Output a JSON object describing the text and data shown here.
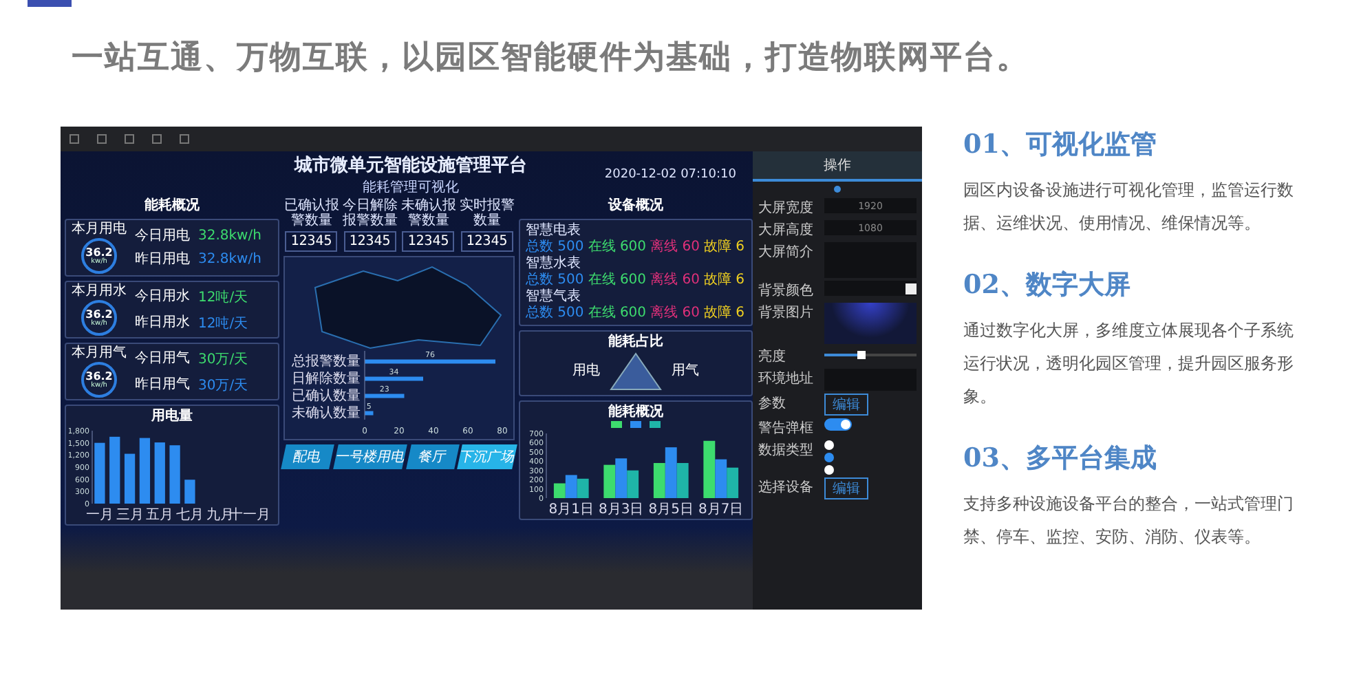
{
  "headline": "一站互通、万物互联，以园区智能硬件为基础，打造物联网平台。",
  "dashboard": {
    "title": "城市微单元智能设施管理平台",
    "subtitle": "能耗管理可视化",
    "datetime": "2020-12-02 07:10:10",
    "energy_overview": {
      "heading": "能耗概况",
      "cards": [
        {
          "month_label": "本月用电",
          "gauge_value": "36.2",
          "gauge_unit": "kw/h",
          "rows": [
            {
              "label": "今日用电",
              "value": "32.8kw/h"
            },
            {
              "label": "昨日用电",
              "value": "32.8kw/h"
            }
          ]
        },
        {
          "month_label": "本月用水",
          "gauge_value": "36.2",
          "gauge_unit": "kw/h",
          "rows": [
            {
              "label": "今日用水",
              "value": "12吨/天"
            },
            {
              "label": "昨日用水",
              "value": "12吨/天"
            }
          ]
        },
        {
          "month_label": "本月用气",
          "gauge_value": "36.2",
          "gauge_unit": "kw/h",
          "rows": [
            {
              "label": "今日用气",
              "value": "30万/天"
            },
            {
              "label": "昨日用气",
              "value": "30万/天"
            }
          ]
        }
      ]
    },
    "electricity_chart": {
      "title": "用电量",
      "chart_data": {
        "type": "bar",
        "categories": [
          "一月",
          null,
          "三月",
          null,
          "五月",
          null,
          "七月",
          null,
          "九月",
          null,
          "十一月",
          null
        ],
        "values": [
          1500,
          1650,
          1230,
          1620,
          1510,
          1440,
          590,
          0,
          0,
          0,
          0,
          0
        ],
        "ylim": [
          0,
          1800
        ],
        "yticks": [
          {
            "value": 0,
            "label": "0"
          },
          {
            "value": 300,
            "label": "300"
          },
          {
            "value": 600,
            "label": "600"
          },
          {
            "value": 900,
            "label": "900"
          },
          {
            "value": 1200,
            "label": "1,200"
          },
          {
            "value": 1500,
            "label": "1,500"
          },
          {
            "value": 1800,
            "label": "1,800"
          }
        ]
      }
    },
    "counters": [
      {
        "label": "已确认报警数量",
        "value": "12345"
      },
      {
        "label": "今日解除报警数量",
        "value": "12345"
      },
      {
        "label": "未确认报警数量",
        "value": "12345"
      },
      {
        "label": "实时报警数量",
        "value": "12345"
      }
    ],
    "alarm_chart": {
      "chart_data": {
        "type": "bar",
        "orientation": "horizontal",
        "categories": [
          "总报警数量",
          "日解除数量",
          "已确认数量",
          "未确认数量"
        ],
        "values": [
          76,
          34,
          23,
          5
        ],
        "data_labels": true,
        "xlim": [
          0,
          80
        ],
        "xticks": [
          0,
          20,
          40,
          60,
          80
        ]
      }
    },
    "bottom_tabs": [
      {
        "label": "配电",
        "selected": false
      },
      {
        "label": "一号楼用电",
        "selected": false
      },
      {
        "label": "餐厅",
        "selected": false
      },
      {
        "label": "下沉广场",
        "selected": true
      }
    ],
    "device_overview": {
      "heading": "设备概况",
      "devices": [
        {
          "name": "智慧电表",
          "total": "总数 500",
          "online": "在线 600",
          "offline": "离线 60",
          "fault": "故障 6"
        },
        {
          "name": "智慧水表",
          "total": "总数 500",
          "online": "在线 600",
          "offline": "离线 60",
          "fault": "故障 6"
        },
        {
          "name": "智慧气表",
          "total": "总数 500",
          "online": "在线 600",
          "offline": "离线 60",
          "fault": "故障 6"
        }
      ]
    },
    "energy_share": {
      "heading": "能耗占比",
      "labels": [
        "用电",
        "用气"
      ]
    },
    "energy_chart": {
      "title": "能耗概况",
      "chart_data": {
        "type": "bar",
        "categories": [
          "8月1日",
          "8月3日",
          "8月5日",
          "8月7日"
        ],
        "ylim": [
          0,
          700
        ],
        "yticks": [
          0,
          100,
          200,
          300,
          400,
          500,
          600,
          700
        ],
        "series": [
          {
            "color": "#3ddc6e",
            "values": [
              160,
              360,
              380,
              620
            ]
          },
          {
            "color": "#2d8cf0",
            "values": [
              250,
              430,
              550,
              420
            ]
          },
          {
            "color": "#1fb5a8",
            "values": [
              210,
              300,
              380,
              330
            ]
          }
        ]
      }
    },
    "settings": {
      "tab": "操作",
      "fields": [
        {
          "kind": "number",
          "label": "大屏宽度",
          "value": "1920"
        },
        {
          "kind": "number",
          "label": "大屏高度",
          "value": "1080"
        },
        {
          "kind": "textarea",
          "label": "大屏简介"
        },
        {
          "kind": "color",
          "label": "背景颜色"
        },
        {
          "kind": "image",
          "label": "背景图片"
        },
        {
          "kind": "slider",
          "label": "亮度",
          "level": 0.4
        },
        {
          "kind": "textarea",
          "label": "环境地址"
        },
        {
          "kind": "button",
          "label": "参数",
          "value": "编辑"
        },
        {
          "kind": "switch",
          "label": "警告弹框",
          "on": true
        },
        {
          "kind": "radio",
          "label": "数据类型",
          "options": [
            {
              "selected": false
            },
            {
              "selected": true
            },
            {
              "selected": false
            }
          ]
        },
        {
          "kind": "button",
          "label": "选择设备",
          "value": "编辑"
        }
      ]
    }
  },
  "features": [
    {
      "heading": "01、可视化监管",
      "body": "园区内设备设施进行可视化管理，监管运行数据、运维状况、使用情况、维保情况等。"
    },
    {
      "heading": "02、数字大屏",
      "body": "通过数字化大屏，多维度立体展现各个子系统运行状况，透明化园区管理，提升园区服务形象。"
    },
    {
      "heading": "03、多平台集成",
      "body": "支持多种设施设备平台的整合，一站式管理门禁、停车、监控、安防、消防、仪表等。"
    }
  ]
}
